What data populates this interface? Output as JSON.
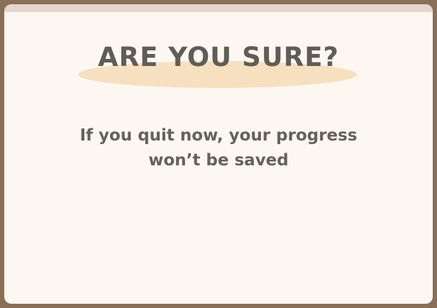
{
  "dialog": {
    "title": "ARE YOU SURE?",
    "message_line1": "If you quit now, your progress",
    "message_line2": "won’t be saved"
  },
  "colors": {
    "frame": "#8a6e57",
    "panel": "#fdf7f2",
    "top_strip": "#e2d6ce",
    "title_highlight": "#f6e0c0",
    "text": "#5f5d55"
  }
}
